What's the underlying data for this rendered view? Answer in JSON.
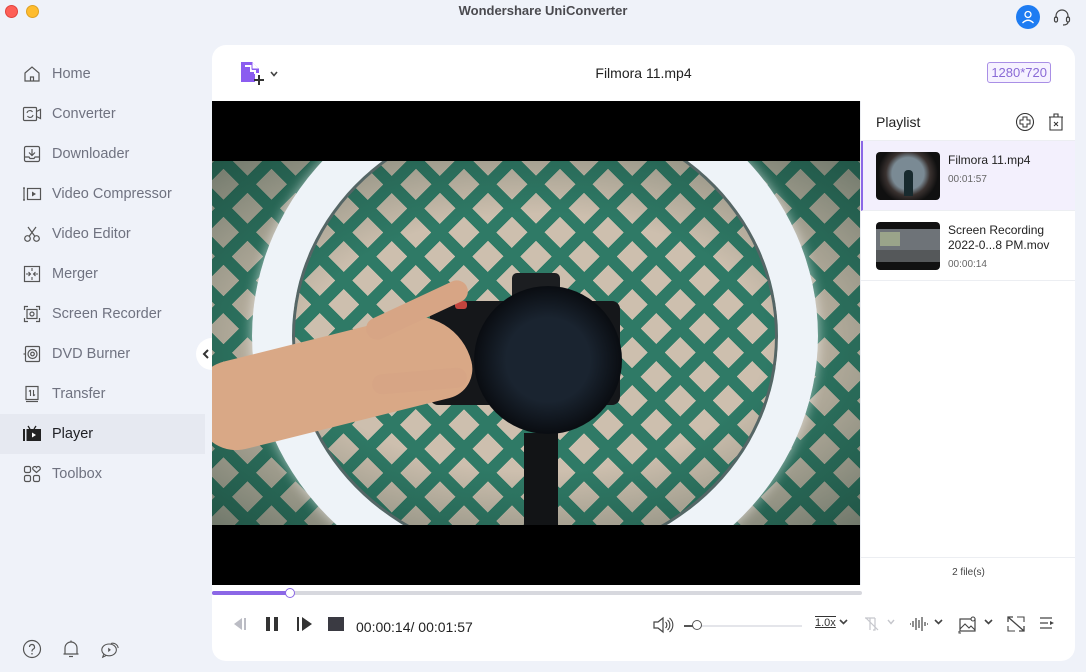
{
  "window": {
    "title": "Wondershare UniConverter",
    "traffic_lights": [
      "close",
      "minimize"
    ]
  },
  "top_right": {
    "account_icon": "user-icon",
    "support_icon": "headset-icon",
    "accent_color": "#1e7cf2"
  },
  "sidebar": {
    "items": [
      {
        "label": "Home",
        "icon": "home-icon",
        "active": false
      },
      {
        "label": "Converter",
        "icon": "converter-icon",
        "active": false
      },
      {
        "label": "Downloader",
        "icon": "download-icon",
        "active": false
      },
      {
        "label": "Video Compressor",
        "icon": "compress-icon",
        "active": false
      },
      {
        "label": "Video Editor",
        "icon": "scissors-icon",
        "active": false
      },
      {
        "label": "Merger",
        "icon": "merge-icon",
        "active": false
      },
      {
        "label": "Screen Recorder",
        "icon": "record-screen-icon",
        "active": false
      },
      {
        "label": "DVD Burner",
        "icon": "disc-icon",
        "active": false
      },
      {
        "label": "Transfer",
        "icon": "transfer-icon",
        "active": false
      },
      {
        "label": "Player",
        "icon": "tv-icon",
        "active": true
      },
      {
        "label": "Toolbox",
        "icon": "grid-icon",
        "active": false
      }
    ],
    "bottom_icons": [
      "help-icon",
      "bell-icon",
      "feedback-icon"
    ]
  },
  "player": {
    "file_title": "Filmora 11.mp4",
    "resolution": "1280*720",
    "current_time": "00:00:14",
    "separator": "/",
    "total_time": "00:01:57",
    "progress": 0.12,
    "volume": 0.11,
    "speed": "1.0x",
    "accent_color": "#8b67e6"
  },
  "playlist": {
    "title": "Playlist",
    "items": [
      {
        "name": "Filmora 11.mp4",
        "duration": "00:01:57",
        "active": true
      },
      {
        "name": "Screen Recording 2022-0...8 PM.mov",
        "duration": "00:00:14",
        "active": false
      }
    ],
    "footer": "2 file(s)"
  }
}
